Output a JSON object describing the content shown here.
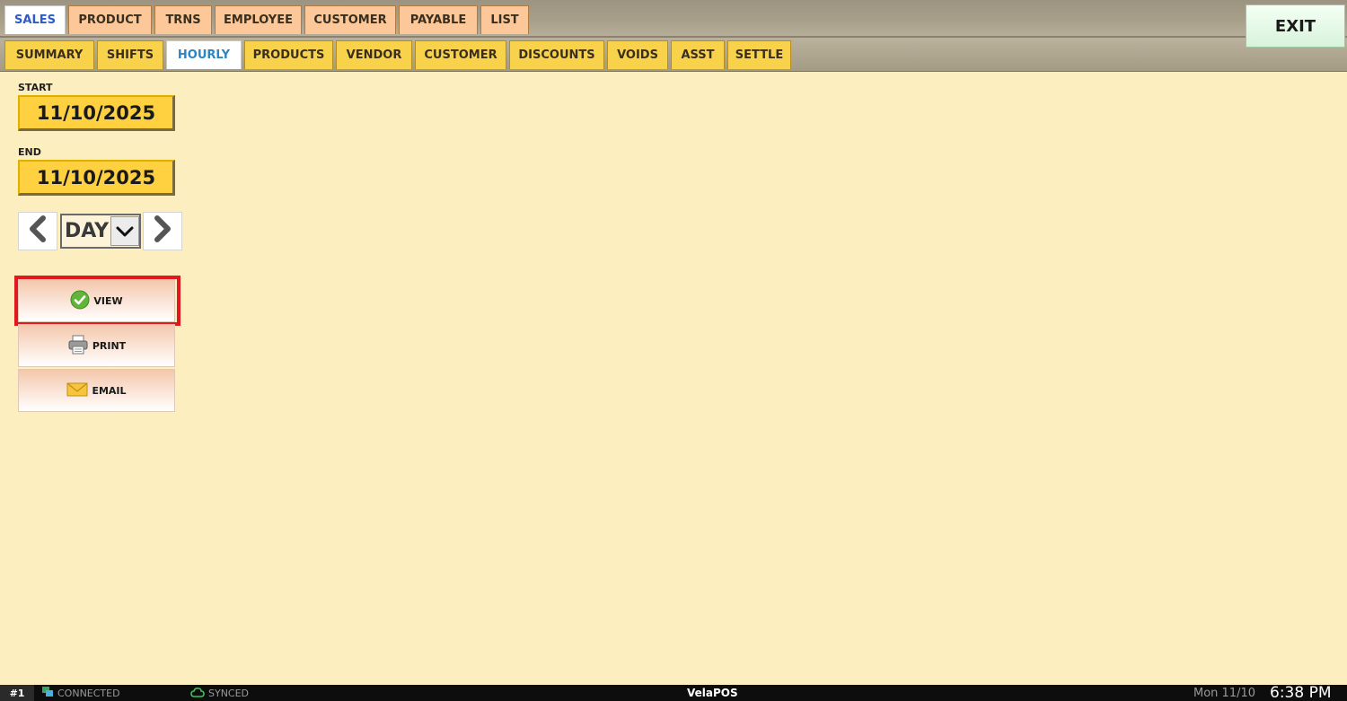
{
  "colors": {
    "background": "#fdeebf",
    "primary_tab": "#fcc89a",
    "secondary_tab": "#f9d24b",
    "date_button": "#ffd040",
    "highlight": "#e0191f",
    "exit_button": "#d8f3dc"
  },
  "primary_tabs": [
    {
      "label": "SALES",
      "active": true
    },
    {
      "label": "PRODUCT",
      "active": false
    },
    {
      "label": "TRNS",
      "active": false
    },
    {
      "label": "EMPLOYEE",
      "active": false
    },
    {
      "label": "CUSTOMER",
      "active": false
    },
    {
      "label": "PAYABLE",
      "active": false
    },
    {
      "label": "LIST",
      "active": false
    }
  ],
  "secondary_tabs": [
    {
      "label": "SUMMARY",
      "active": false
    },
    {
      "label": "SHIFTS",
      "active": false
    },
    {
      "label": "HOURLY",
      "active": true
    },
    {
      "label": "PRODUCTS",
      "active": false
    },
    {
      "label": "VENDOR",
      "active": false
    },
    {
      "label": "CUSTOMER",
      "active": false
    },
    {
      "label": "DISCOUNTS",
      "active": false
    },
    {
      "label": "VOIDS",
      "active": false
    },
    {
      "label": "ASST",
      "active": false
    },
    {
      "label": "SETTLE",
      "active": false
    }
  ],
  "exit_label": "EXIT",
  "filters": {
    "start_label": "START",
    "start_date": "11/10/2025",
    "end_label": "END",
    "end_date": "11/10/2025",
    "period": "DAY"
  },
  "actions": {
    "view": {
      "label": "VIEW",
      "icon": "check-circle-icon"
    },
    "print": {
      "label": "PRINT",
      "icon": "printer-icon"
    },
    "email": {
      "label": "EMAIL",
      "icon": "envelope-icon"
    }
  },
  "status": {
    "terminal": "#1",
    "connection": "CONNECTED",
    "sync": "SYNCED",
    "brand_prefix": "Vela",
    "brand_suffix": "POS",
    "date": "Mon 11/10",
    "time": "6:38 PM"
  }
}
